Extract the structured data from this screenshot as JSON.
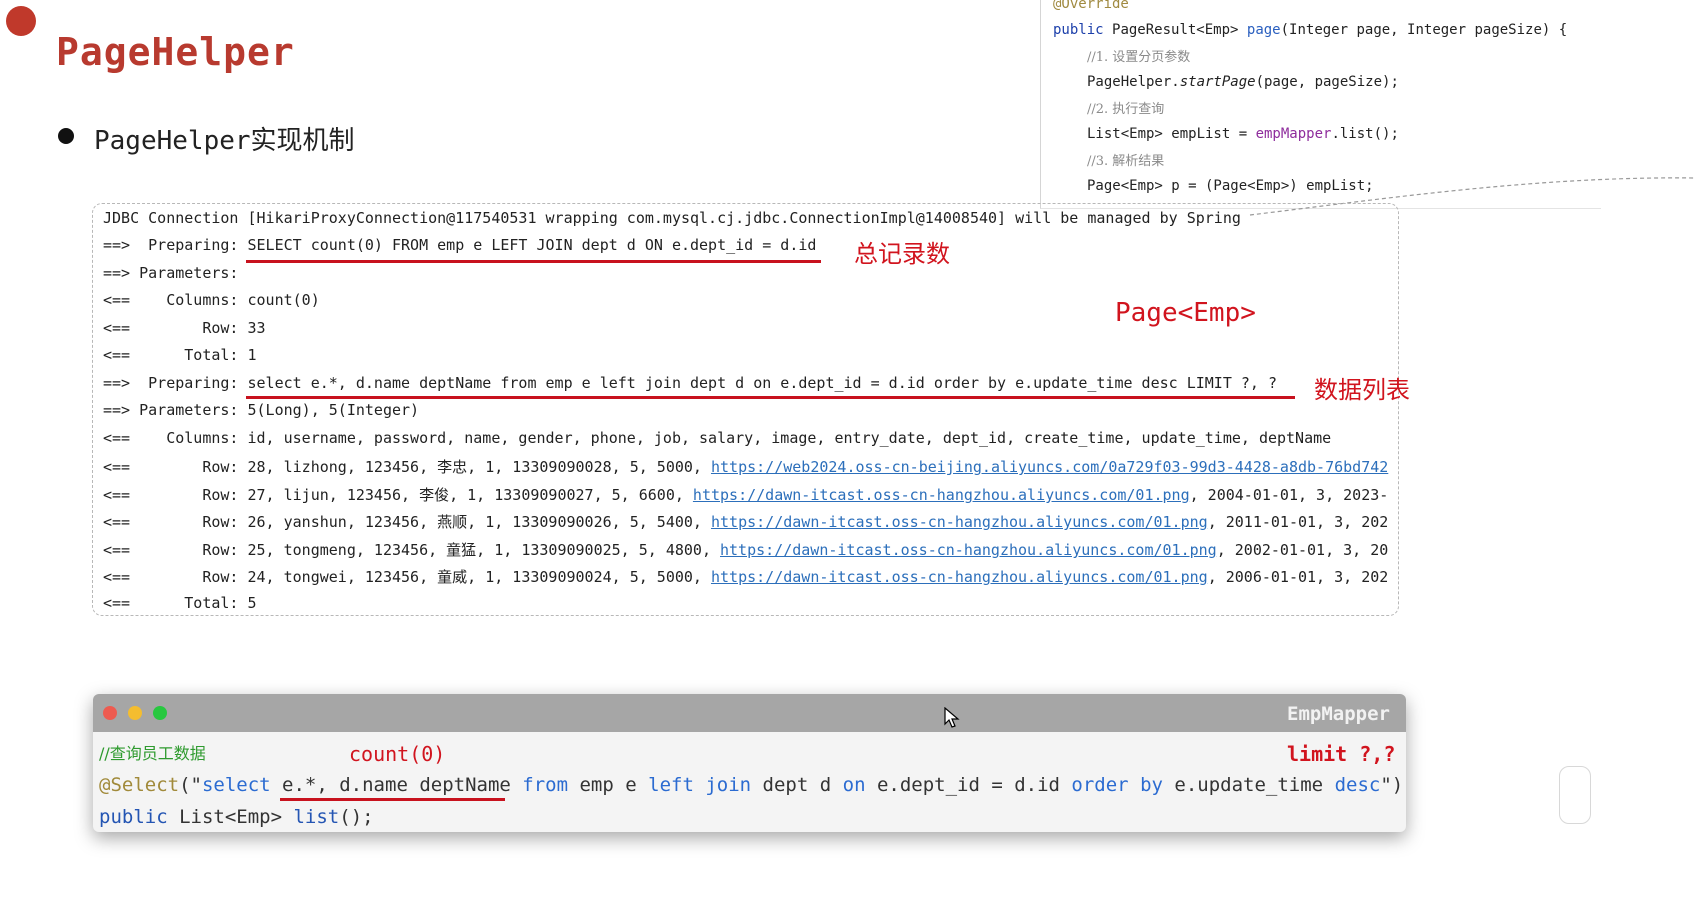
{
  "slide": {
    "title": "PageHelper",
    "bullet": "PageHelper实现机制"
  },
  "snippet": {
    "line1": "@Override",
    "line2_kw": "public",
    "line2_type": "PageResult<Emp>",
    "line2_name": "page",
    "line2_params": "(Integer page, Integer pageSize) {",
    "c1": "//1. 设置分页参数",
    "line4_obj": "PageHelper.",
    "line4_method": "startPage",
    "line4_args": "(page, pageSize);",
    "c2": "//2. 执行查询",
    "line6_a": "List<Emp> empList = ",
    "line6_b": "empMapper",
    "line6_c": ".list();",
    "c3": "//3. 解析结果",
    "line8": "Page<Emp> p = (Page<Emp>) empList;"
  },
  "log": {
    "l0": "JDBC Connection [HikariProxyConnection@117540531 wrapping com.mysql.cj.jdbc.ConnectionImpl@14008540] will be managed by Spring",
    "l1": "==>  Preparing: SELECT count(0) FROM emp e LEFT JOIN dept d ON e.dept_id = d.id",
    "l2": "==> Parameters: ",
    "l3": "<==    Columns: count(0)",
    "l4": "<==        Row: 33",
    "l5": "<==      Total: 1",
    "l6": "==>  Preparing: select e.*, d.name deptName from emp e left join dept d on e.dept_id = d.id order by e.update_time desc LIMIT ?, ?",
    "l7": "==> Parameters: 5(Long), 5(Integer)",
    "l8": "<==    Columns: id, username, password, name, gender, phone, job, salary, image, entry_date, dept_id, create_time, update_time, deptName",
    "rows": [
      {
        "pre": "<==        Row: 28, lizhong, 123456, 李忠, 1, 13309090028, 5, 5000, ",
        "link": "https://web2024.oss-cn-beijing.aliyuncs.com/0a729f03-99d3-4428-a8db-76bd742",
        "post": ""
      },
      {
        "pre": "<==        Row: 27, lijun, 123456, 李俊, 1, 13309090027, 5, 6600, ",
        "link": "https://dawn-itcast.oss-cn-hangzhou.aliyuncs.com/01.png",
        "post": ", 2004-01-01, 3, 2023-"
      },
      {
        "pre": "<==        Row: 26, yanshun, 123456, 燕顺, 1, 13309090026, 5, 5400, ",
        "link": "https://dawn-itcast.oss-cn-hangzhou.aliyuncs.com/01.png",
        "post": ", 2011-01-01, 3, 202"
      },
      {
        "pre": "<==        Row: 25, tongmeng, 123456, 童猛, 1, 13309090025, 5, 4800, ",
        "link": "https://dawn-itcast.oss-cn-hangzhou.aliyuncs.com/01.png",
        "post": ", 2002-01-01, 3, 20"
      },
      {
        "pre": "<==        Row: 24, tongwei, 123456, 童威, 1, 13309090024, 5, 5000, ",
        "link": "https://dawn-itcast.oss-cn-hangzhou.aliyuncs.com/01.png",
        "post": ", 2006-01-01, 3, 202"
      }
    ],
    "l14": "<==      Total: 5"
  },
  "labels": {
    "total_count": "总记录数",
    "page_emp": "Page<Emp>",
    "data_list": "数据列表"
  },
  "mapper": {
    "title": "EmpMapper",
    "comment": "//查询员工数据",
    "count_label": "count(0)",
    "limit_label": "limit ?,?",
    "select_annot": "@Select",
    "select_open": "(\"",
    "kw_select": "select",
    "sql_fields": " e.*, d.name deptName ",
    "kw_from": "from",
    "sql_emp": " emp e ",
    "kw_left": "left",
    "kw_join": "join",
    "sql_dept": " dept d ",
    "kw_on": "on",
    "sql_cond": " e.dept_id = d.id ",
    "kw_order": "order",
    "kw_by": "by",
    "sql_upd": " e.update_time ",
    "kw_desc": "desc",
    "select_close": "\")",
    "sig_kw": "public",
    "sig_type": " List<Emp> ",
    "sig_name": "list",
    "sig_end": "();"
  },
  "colors": {
    "accent_red": "#c8121e",
    "title_red": "#b83a2f",
    "link_blue": "#2c6fbb"
  }
}
